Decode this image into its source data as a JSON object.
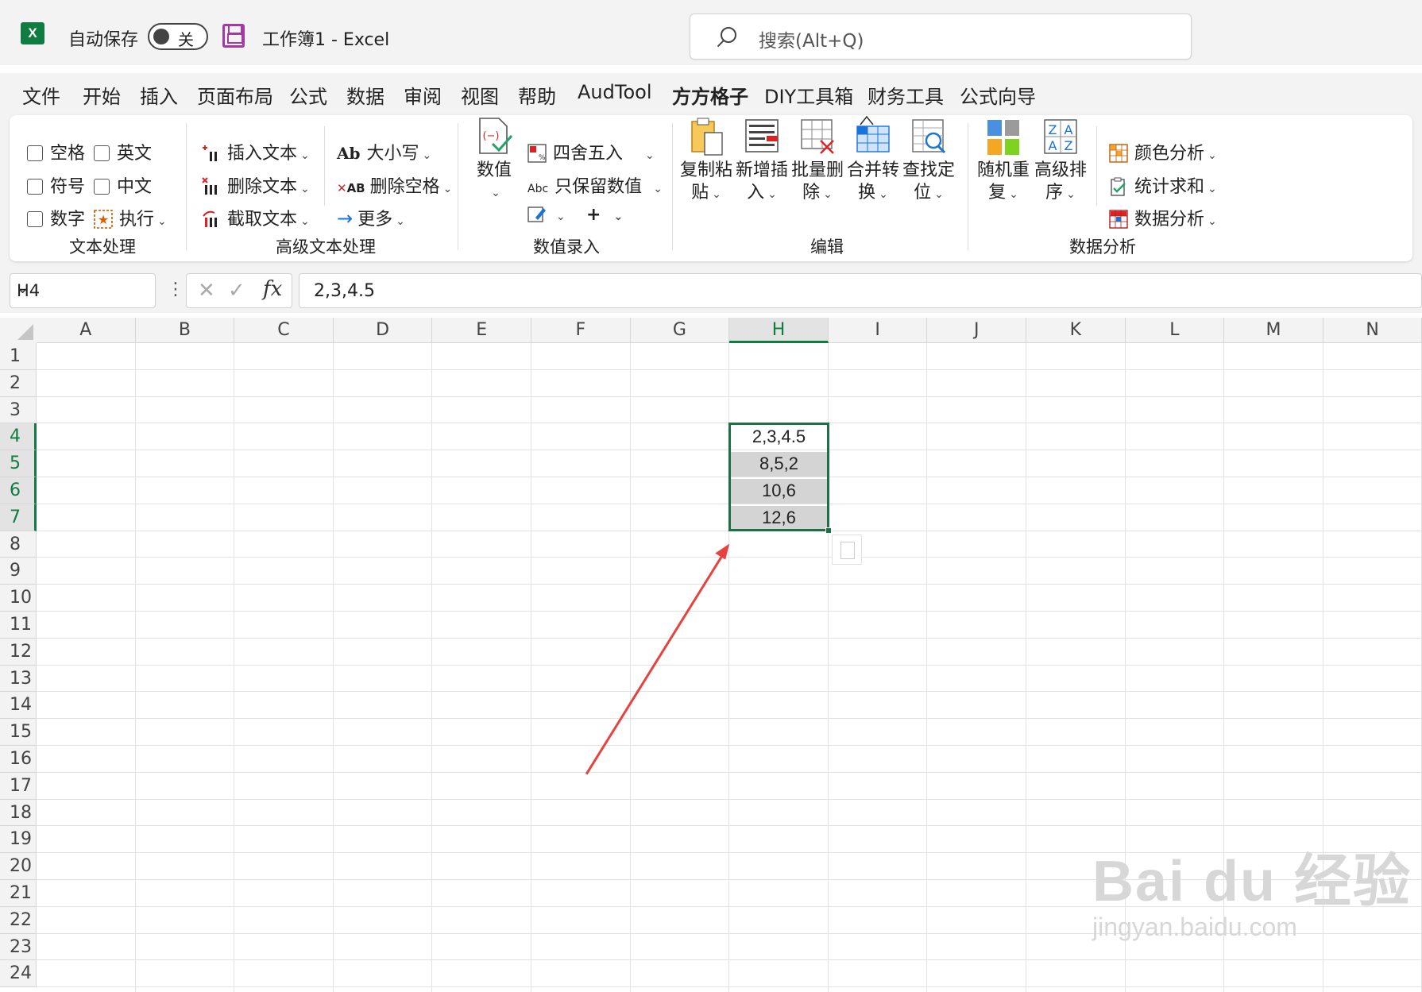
{
  "titlebar": {
    "autosave_label": "自动保存",
    "autosave_state": "关",
    "doc_title": "工作簿1  -  Excel",
    "search_placeholder": "搜索(Alt+Q)"
  },
  "tabs": [
    "文件",
    "开始",
    "插入",
    "页面布局",
    "公式",
    "数据",
    "审阅",
    "视图",
    "帮助",
    "AudTool",
    "方方格子",
    "DIY工具箱",
    "财务工具",
    "公式向导"
  ],
  "active_tab": "方方格子",
  "ribbon": {
    "text_group": {
      "label": "文本处理",
      "checkboxes": [
        "空格",
        "英文",
        "符号",
        "中文",
        "数字"
      ],
      "execute": "执行"
    },
    "adv_text_group": {
      "label": "高级文本处理",
      "insert_text": "插入文本",
      "delete_text": "删除文本",
      "extract_text": "截取文本",
      "case": "大小写",
      "delete_space": "删除空格",
      "more": "更多"
    },
    "num_group": {
      "label": "数值录入",
      "value_btn": "数值",
      "round": "四舍五入",
      "keep_num": "只保留数值",
      "abc": "Abc"
    },
    "edit_group": {
      "label": "编辑",
      "buttons": [
        {
          "l1": "复制粘",
          "l2": "贴"
        },
        {
          "l1": "新增插",
          "l2": "入"
        },
        {
          "l1": "批量删",
          "l2": "除"
        },
        {
          "l1": "合并转",
          "l2": "换"
        },
        {
          "l1": "查找定",
          "l2": "位"
        }
      ]
    },
    "analysis_group": {
      "label": "数据分析",
      "random": {
        "l1": "随机重",
        "l2": "复"
      },
      "sort": {
        "l1": "高级排",
        "l2": "序"
      },
      "color_analysis": "颜色分析",
      "stat_sum": "统计求和",
      "data_analysis": "数据分析"
    }
  },
  "formula_bar": {
    "name_box": "H4",
    "fx": "fx",
    "formula": "2,3,4.5"
  },
  "columns": [
    "A",
    "B",
    "C",
    "D",
    "E",
    "F",
    "G",
    "H",
    "I",
    "J",
    "K",
    "L",
    "M",
    "N"
  ],
  "rows": [
    "1",
    "2",
    "3",
    "4",
    "5",
    "6",
    "7",
    "8",
    "9",
    "10",
    "11",
    "12",
    "13",
    "14",
    "15",
    "16",
    "17",
    "18",
    "19",
    "20",
    "21",
    "22",
    "23",
    "24"
  ],
  "selected_cell": "H4",
  "cells": {
    "H4": "2,3,4.5",
    "H5": "8,5,2",
    "H6": "10,6",
    "H7": "12,6"
  },
  "colors": {
    "accent": "#107c41",
    "selection_border": "#1e7145",
    "highlight_fill": "#d4d4d4",
    "arrow": "#e8423f"
  },
  "watermark": {
    "main": "Bai du 经验",
    "sub": "jingyan.baidu.com"
  }
}
